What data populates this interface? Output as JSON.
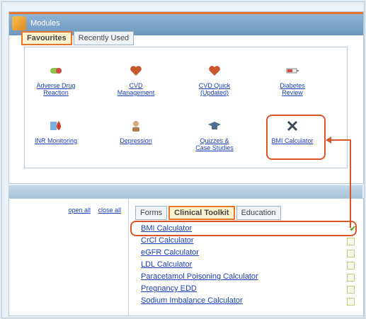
{
  "modules_panel": {
    "title": "Modules",
    "tabs": [
      {
        "label": "Favourites",
        "active": true
      },
      {
        "label": "Recently Used",
        "active": false
      }
    ],
    "favourites": [
      {
        "label_line1": "Adverse Drug",
        "label_line2": "Reaction",
        "icon": "pill-icon"
      },
      {
        "label_line1": "CVD",
        "label_line2": "Management",
        "icon": "heart-icon"
      },
      {
        "label_line1": "CVD Quick",
        "label_line2": "(Updated)",
        "icon": "heart-icon"
      },
      {
        "label_line1": "Diabetes",
        "label_line2": "Review",
        "icon": "syringe-icon"
      },
      {
        "label_line1": "INR Monitoring",
        "label_line2": "",
        "icon": "blood-drop-icon"
      },
      {
        "label_line1": "Depression",
        "label_line2": "",
        "icon": "person-icon"
      },
      {
        "label_line1": "Quizzes &",
        "label_line2": "Case Studies",
        "icon": "graduation-cap-icon"
      },
      {
        "label_line1": "BMI Calculator",
        "label_line2": "",
        "icon": "tools-icon"
      }
    ]
  },
  "lower_panel": {
    "open_all": "open all",
    "close_all": "close all",
    "tabs": [
      {
        "label": "Forms",
        "active": false
      },
      {
        "label": "Clinical Toolkit",
        "active": true
      },
      {
        "label": "Education",
        "active": false
      }
    ],
    "calculators": [
      {
        "label": "BMI Calculator",
        "checked": true
      },
      {
        "label": "CrCl Calculator",
        "checked": false
      },
      {
        "label": "eGFR Calculator",
        "checked": false
      },
      {
        "label": "LDL Calculator",
        "checked": false
      },
      {
        "label": "Paracetamol Poisoning Calculator",
        "checked": false
      },
      {
        "label": "Pregnancy EDD",
        "checked": false
      },
      {
        "label": "Sodium Imbalance Calculator",
        "checked": false
      }
    ]
  },
  "colors": {
    "accent": "#e8732a",
    "highlight": "#d9562a",
    "link": "#1a3fb3",
    "check": "#5fa32b"
  }
}
